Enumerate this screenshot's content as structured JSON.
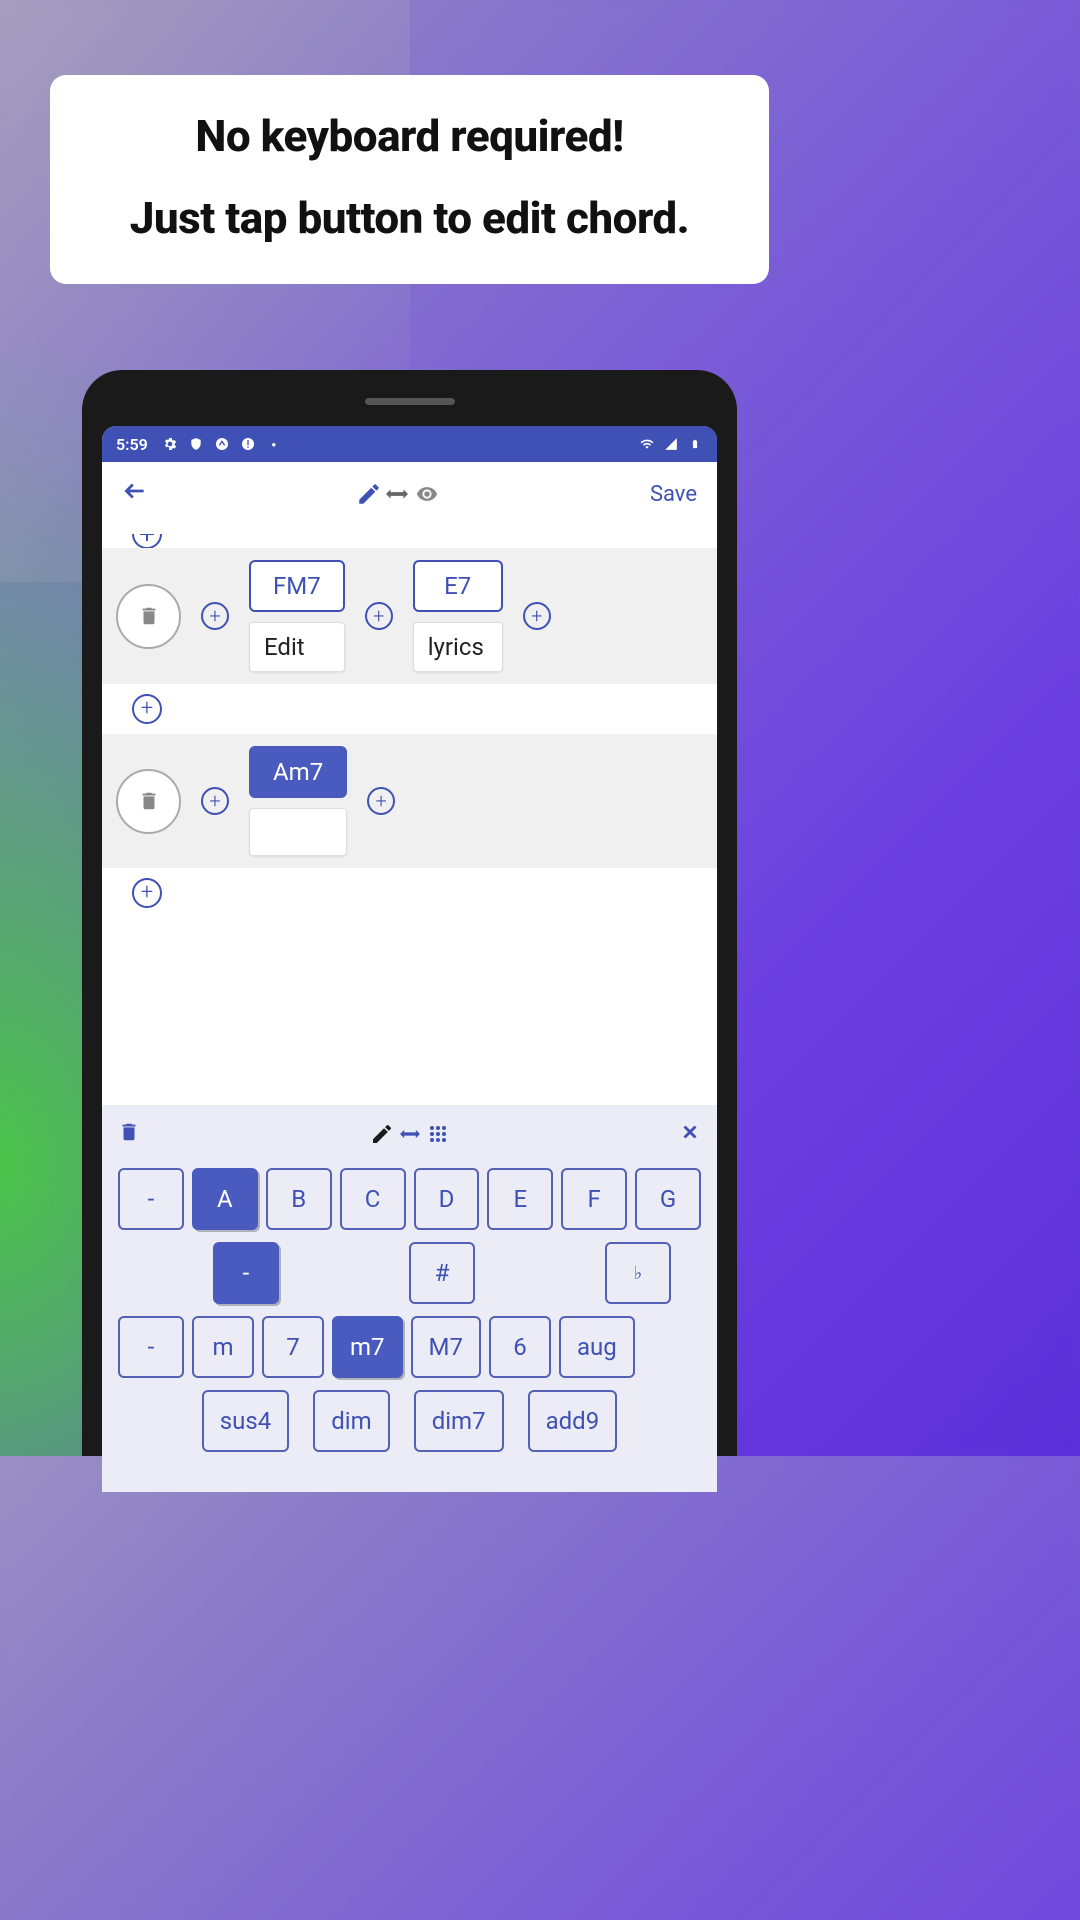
{
  "callout": {
    "line1": "No keyboard required!",
    "line2": "Just tap button to edit chord."
  },
  "statusbar": {
    "time": "5:59"
  },
  "appbar": {
    "save": "Save"
  },
  "rows": [
    {
      "cells": [
        {
          "chord": "FM7",
          "lyric": "Edit",
          "selected": false
        },
        {
          "chord": "E7",
          "lyric": "lyrics",
          "selected": false
        }
      ]
    },
    {
      "cells": [
        {
          "chord": "Am7",
          "lyric": "",
          "selected": true
        }
      ]
    }
  ],
  "keyboard": {
    "row1": [
      "-",
      "A",
      "B",
      "C",
      "D",
      "E",
      "F",
      "G"
    ],
    "row1_active": 1,
    "row2": [
      "-",
      "#",
      "♭"
    ],
    "row2_active": 0,
    "row3": [
      "-",
      "m",
      "7",
      "m7",
      "M7",
      "6",
      "aug"
    ],
    "row3_active": 3,
    "row4": [
      "sus4",
      "dim",
      "dim7",
      "add9"
    ]
  }
}
